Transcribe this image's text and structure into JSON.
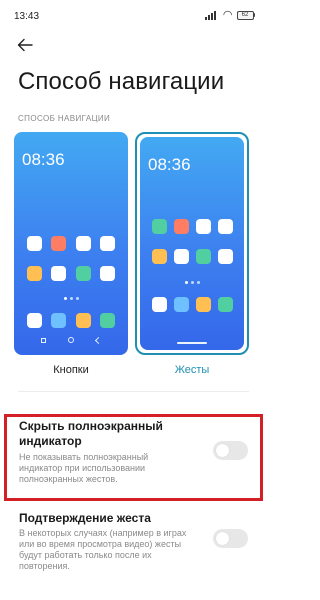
{
  "status_bar": {
    "time": "13:43",
    "battery_level": "62",
    "icons": [
      "signal-icon",
      "wifi-icon",
      "battery-icon"
    ]
  },
  "header": {
    "back_icon": "arrow-left-icon",
    "title": "Способ навигации"
  },
  "navigation_section": {
    "label": "СПОСОБ НАВИГАЦИИ",
    "options": [
      {
        "label": "Кнопки",
        "selected": false,
        "preview_time": "08:36",
        "icon_colors_row1": [
          "#ffffff",
          "#ff7e63",
          "#ffffff",
          "#ffffff"
        ],
        "icon_colors_row2": [
          "#ffbf53",
          "#ffffff",
          "#52cfa1",
          "#ffffff"
        ]
      },
      {
        "label": "Жесты",
        "selected": true,
        "preview_time": "08:36",
        "icon_colors_row1": [
          "#52cfa1",
          "#ff7e63",
          "#ffffff",
          "#ffffff"
        ],
        "icon_colors_row2": [
          "#ffbf53",
          "#ffffff",
          "#52cfa1",
          "#ffffff"
        ]
      }
    ],
    "dock_colors": [
      "#ffffff",
      "#6fc0ff",
      "#ffbf53",
      "#52cfa1"
    ]
  },
  "settings": [
    {
      "title": "Скрыть полноэкранный индикатор",
      "description": "Не показывать полноэкранный индикатор при использовании полноэкранных жестов.",
      "enabled": false
    },
    {
      "title": "Подтверждение жеста",
      "description": "В некоторых случаях (например в играх или во время просмотра видео) жесты будут работать только после их повторения.",
      "enabled": false
    }
  ],
  "colors": {
    "accent": "#1f8fb3",
    "highlight_border": "#d32027",
    "toggle_off": "#e7e7e7"
  }
}
